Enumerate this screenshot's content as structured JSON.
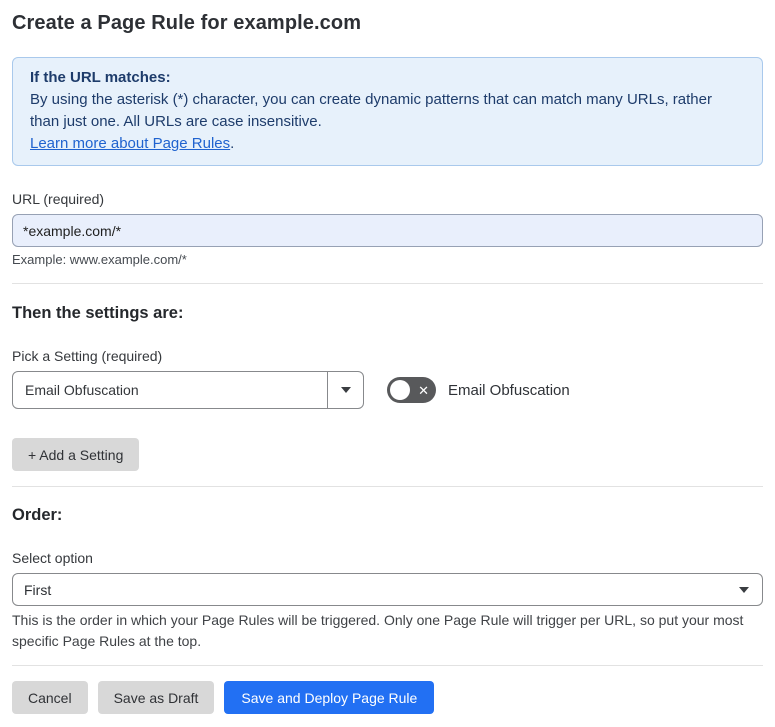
{
  "page": {
    "title": "Create a Page Rule for example.com"
  },
  "info_box": {
    "heading": "If the URL matches:",
    "body": "By using the asterisk (*) character, you can create dynamic patterns that can match many URLs, rather than just one. All URLs are case insensitive.",
    "link_label": "Learn more about Page Rules",
    "link_suffix": "."
  },
  "url_field": {
    "label": "URL (required)",
    "value": "*example.com/*",
    "helper": "Example: www.example.com/*"
  },
  "settings_section": {
    "heading": "Then the settings are:",
    "picker_label": "Pick a Setting (required)",
    "picker_value": "Email Obfuscation",
    "toggle_label": "Email Obfuscation",
    "toggle_state": "off",
    "add_setting_label": "+ Add a Setting"
  },
  "order_section": {
    "heading": "Order:",
    "select_label": "Select option",
    "select_value": "First",
    "helper": "This is the order in which your Page Rules will be triggered. Only one Page Rule will trigger per URL, so put your most specific Page Rules at the top."
  },
  "footer": {
    "cancel_label": "Cancel",
    "save_draft_label": "Save as Draft",
    "save_deploy_label": "Save and Deploy Page Rule"
  },
  "icons": {
    "toggle_x": "✕",
    "chevron_down": "▾"
  },
  "colors": {
    "accent_blue": "#2270f3",
    "info_box_bg": "#e7f1fb",
    "info_box_border": "#a9c9ec",
    "info_text": "#1e3c6b",
    "link_blue": "#2063cf",
    "url_input_bg": "#e9effc",
    "toggle_off_bg": "#58595b",
    "gray_button_bg": "#d8d8d8"
  }
}
